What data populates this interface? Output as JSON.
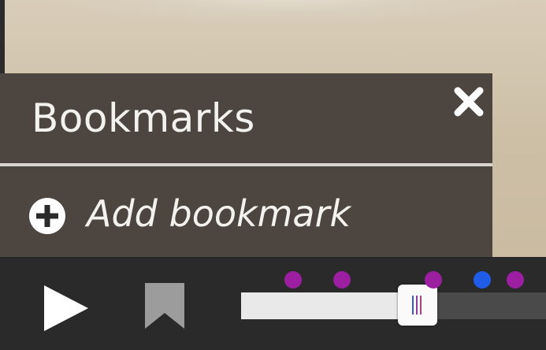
{
  "panel": {
    "title": "Bookmarks",
    "add_label": "Add bookmark",
    "close_icon": "close-icon",
    "add_icon": "plus-circle-icon"
  },
  "player": {
    "play_icon": "play-icon",
    "bookmark_icon": "bookmark-icon",
    "progress": 0.58,
    "markers": [
      {
        "position": 0.17,
        "color": "#9b1fa0"
      },
      {
        "position": 0.33,
        "color": "#9b1fa0"
      },
      {
        "position": 0.63,
        "color": "#9b1fa0"
      },
      {
        "position": 0.79,
        "color": "#1f5de8"
      },
      {
        "position": 0.9,
        "color": "#9b1fa0"
      }
    ]
  },
  "colors": {
    "panel_bg": "#4d4640",
    "control_bar_bg": "#2a2a2b",
    "bookmark_purple": "#9b1fa0",
    "bookmark_blue": "#1f5de8"
  }
}
